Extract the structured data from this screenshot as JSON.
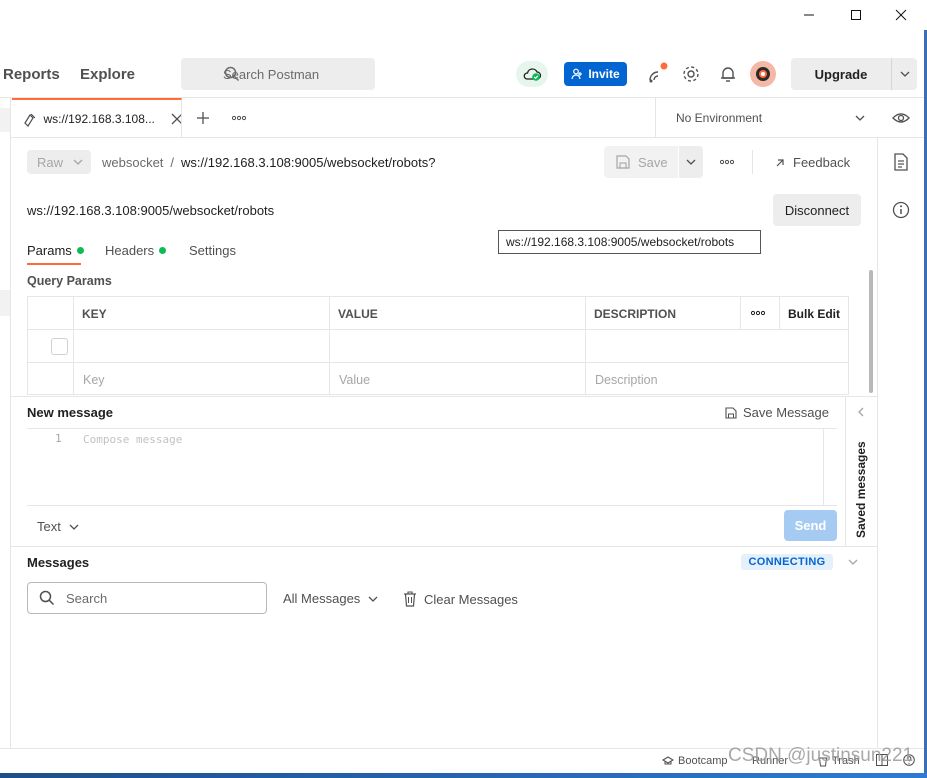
{
  "window": {
    "minimize_icon": "minimize-icon",
    "maximize_icon": "maximize-icon",
    "close_icon": "close-icon"
  },
  "header": {
    "nav": {
      "reports": "Reports",
      "explore": "Explore"
    },
    "search_placeholder": "Search Postman",
    "invite_label": "Invite",
    "upgrade_label": "Upgrade"
  },
  "tabs": {
    "active_tab_label": "ws://192.168.3.108...",
    "environment": "No Environment"
  },
  "request": {
    "raw_label": "Raw",
    "collection": "websocket",
    "separator": "/",
    "name": "ws://192.168.3.108:9005/websocket/robots?",
    "save_label": "Save",
    "feedback_label": "Feedback",
    "url": "ws://192.168.3.108:9005/websocket/robots",
    "disconnect_label": "Disconnect",
    "tooltip": "ws://192.168.3.108:9005/websocket/robots"
  },
  "subtabs": {
    "params": "Params",
    "headers": "Headers",
    "settings": "Settings"
  },
  "query_params": {
    "title": "Query Params",
    "headers": {
      "key": "KEY",
      "value": "VALUE",
      "description": "DESCRIPTION",
      "bulk_edit": "Bulk Edit"
    },
    "placeholders": {
      "key": "Key",
      "value": "Value",
      "description": "Description"
    }
  },
  "new_message": {
    "title": "New message",
    "save_message": "Save Message",
    "line_number": "1",
    "compose_placeholder": "Compose message",
    "format": "Text",
    "send_label": "Send",
    "saved_messages": "Saved messages"
  },
  "messages": {
    "title": "Messages",
    "status": "CONNECTING",
    "search_placeholder": "Search",
    "filter": "All Messages",
    "clear": "Clear Messages"
  },
  "statusbar": {
    "bootcamp": "Bootcamp",
    "runner": "Runner",
    "trash": "Trash"
  },
  "watermark": "CSDN @justinsun221",
  "colors": {
    "accent": "#ff6c37",
    "primary": "#0265d2",
    "success": "#0cbb52"
  }
}
